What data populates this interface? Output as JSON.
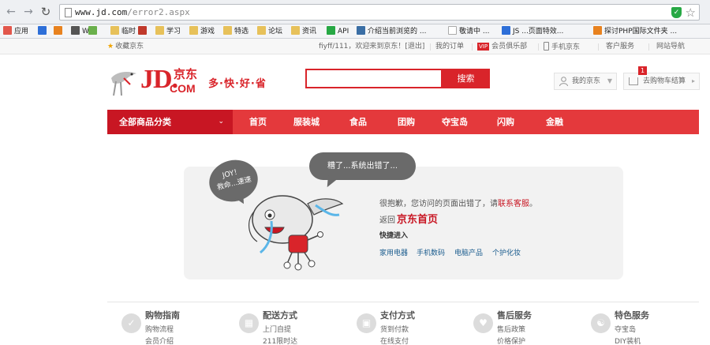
{
  "browser": {
    "url_main": "www.jd.com",
    "url_rest": "/error2.aspx",
    "bookmarks": [
      {
        "label": "应用",
        "color": "#e2574c"
      },
      {
        "label": "",
        "color": "#2e6fd8"
      },
      {
        "label": "",
        "color": "#e8821f"
      },
      {
        "label": "W",
        "color": "#555555"
      },
      {
        "label": "",
        "color": "#6ab04c"
      },
      {
        "label": "临时",
        "color": "#e7c15a"
      },
      {
        "label": "",
        "color": "#c0392b"
      },
      {
        "label": "学习",
        "color": "#e7c15a"
      },
      {
        "label": "游戏",
        "color": "#e7c15a"
      },
      {
        "label": "特选",
        "color": "#e7c15a"
      },
      {
        "label": "论坛",
        "color": "#e7c15a"
      },
      {
        "label": "资讯",
        "color": "#e7c15a"
      },
      {
        "label": "API",
        "color": "#27a844"
      },
      {
        "label": "介绍当前浏览的 ...",
        "color": "#3a6ea5"
      },
      {
        "label": "敬请中 ...",
        "color": "#ffffff"
      },
      {
        "label": "JS ...页面特效...",
        "color": "#2e6fd8"
      },
      {
        "label": "探讨PHP国际文件夹 ...",
        "color": "#e8821f"
      }
    ]
  },
  "topbar": {
    "favorite": "收藏京东",
    "greeting": "fiyff/111，欢迎来到京东！[退出]",
    "orders": "我的订单",
    "vip_badge": "VIP",
    "vip": "会员俱乐部",
    "mobile": "手机京东",
    "service": "客户服务",
    "sitemap": "网站导航"
  },
  "header": {
    "logo_jd": "JD.",
    "logo_cn": "京东",
    "logo_com": "COM",
    "slogan": "多·快·好·省",
    "search_placeholder": "",
    "search_button": "搜索",
    "myjd": "我的京东",
    "cart": "去购物车结算",
    "cart_count": "1"
  },
  "nav": {
    "all_categories": "全部商品分类",
    "items": [
      "首页",
      "服装城",
      "食品",
      "团购",
      "夺宝岛",
      "闪购",
      "金融"
    ]
  },
  "error": {
    "bubble_left_1": "JOY！",
    "bubble_left_2": "救命...速速",
    "bubble_right": "糟了...系统出错了...",
    "message_pre": "很抱歉，您访问的页面出错了，请",
    "message_link": "联系客服",
    "message_end": "。",
    "back_pre": "返回",
    "back_link": "京东首页",
    "quick_title": "快捷进入",
    "quick_links": [
      "家用电器",
      "手机数码",
      "电脑产品",
      "个护化妆"
    ]
  },
  "footer": {
    "sections": [
      {
        "title": "购物指南",
        "links": [
          "购物流程",
          "会员介绍"
        ]
      },
      {
        "title": "配送方式",
        "links": [
          "上门自提",
          "211限时达"
        ]
      },
      {
        "title": "支付方式",
        "links": [
          "货到付款",
          "在线支付"
        ]
      },
      {
        "title": "售后服务",
        "links": [
          "售后政策",
          "价格保护"
        ]
      },
      {
        "title": "特色服务",
        "links": [
          "夺宝岛",
          "DIY装机"
        ]
      }
    ]
  },
  "colors": {
    "brand_red": "#e4393c",
    "dark_red": "#c81623",
    "link_blue": "#1b5c8e"
  }
}
